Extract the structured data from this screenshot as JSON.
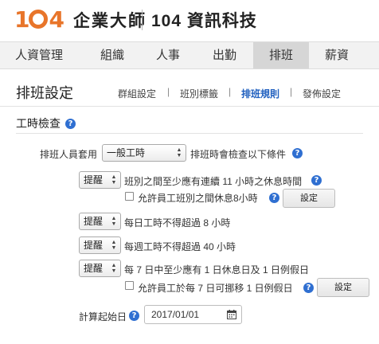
{
  "header": {
    "logo_text": "104",
    "brand": "企業大師",
    "brand2": "104 資訊科技"
  },
  "main_nav": {
    "items": [
      {
        "label": "人資管理"
      },
      {
        "label": "組織"
      },
      {
        "label": "人事"
      },
      {
        "label": "出勤"
      },
      {
        "label": "排班"
      },
      {
        "label": "薪資"
      }
    ],
    "active": "排班"
  },
  "page": {
    "title": "排班設定"
  },
  "sub_nav": {
    "items": [
      {
        "label": "群組設定"
      },
      {
        "label": "班別標籤"
      },
      {
        "label": "排班規則"
      },
      {
        "label": "發佈設定"
      }
    ],
    "separator": "|",
    "active": "排班規則"
  },
  "section": {
    "title": "工時檢查"
  },
  "form": {
    "apply_label": "排班人員套用",
    "apply_value": "一般工時",
    "apply_suffix": "排班時會檢查以下條件",
    "rules": [
      {
        "level": "提醒",
        "text": "班別之間至少應有連續 11 小時之休息時間"
      },
      {
        "level": "提醒",
        "text": "每日工時不得超過 8 小時"
      },
      {
        "level": "提醒",
        "text": "每週工時不得超過 40 小時"
      },
      {
        "level": "提醒",
        "text": "每 7 日中至少應有 1 日休息日及 1 日例假日"
      }
    ],
    "option1_label": "允許員工班別之間休息8小時",
    "option2_label": "允許員工於每 7 日可挪移 1 日例假日",
    "settings_button": "設定",
    "start_date_label": "計算起始日",
    "start_date_value": "2017/01/01"
  },
  "colors": {
    "logo": "#e8752a",
    "active_tab": "#d6d6d6",
    "link_active": "#1f5fbf",
    "help_icon": "#2f6fd1"
  },
  "icons": [
    "help-icon",
    "calendar-icon",
    "select-arrows-icon",
    "checkbox-icon"
  ]
}
